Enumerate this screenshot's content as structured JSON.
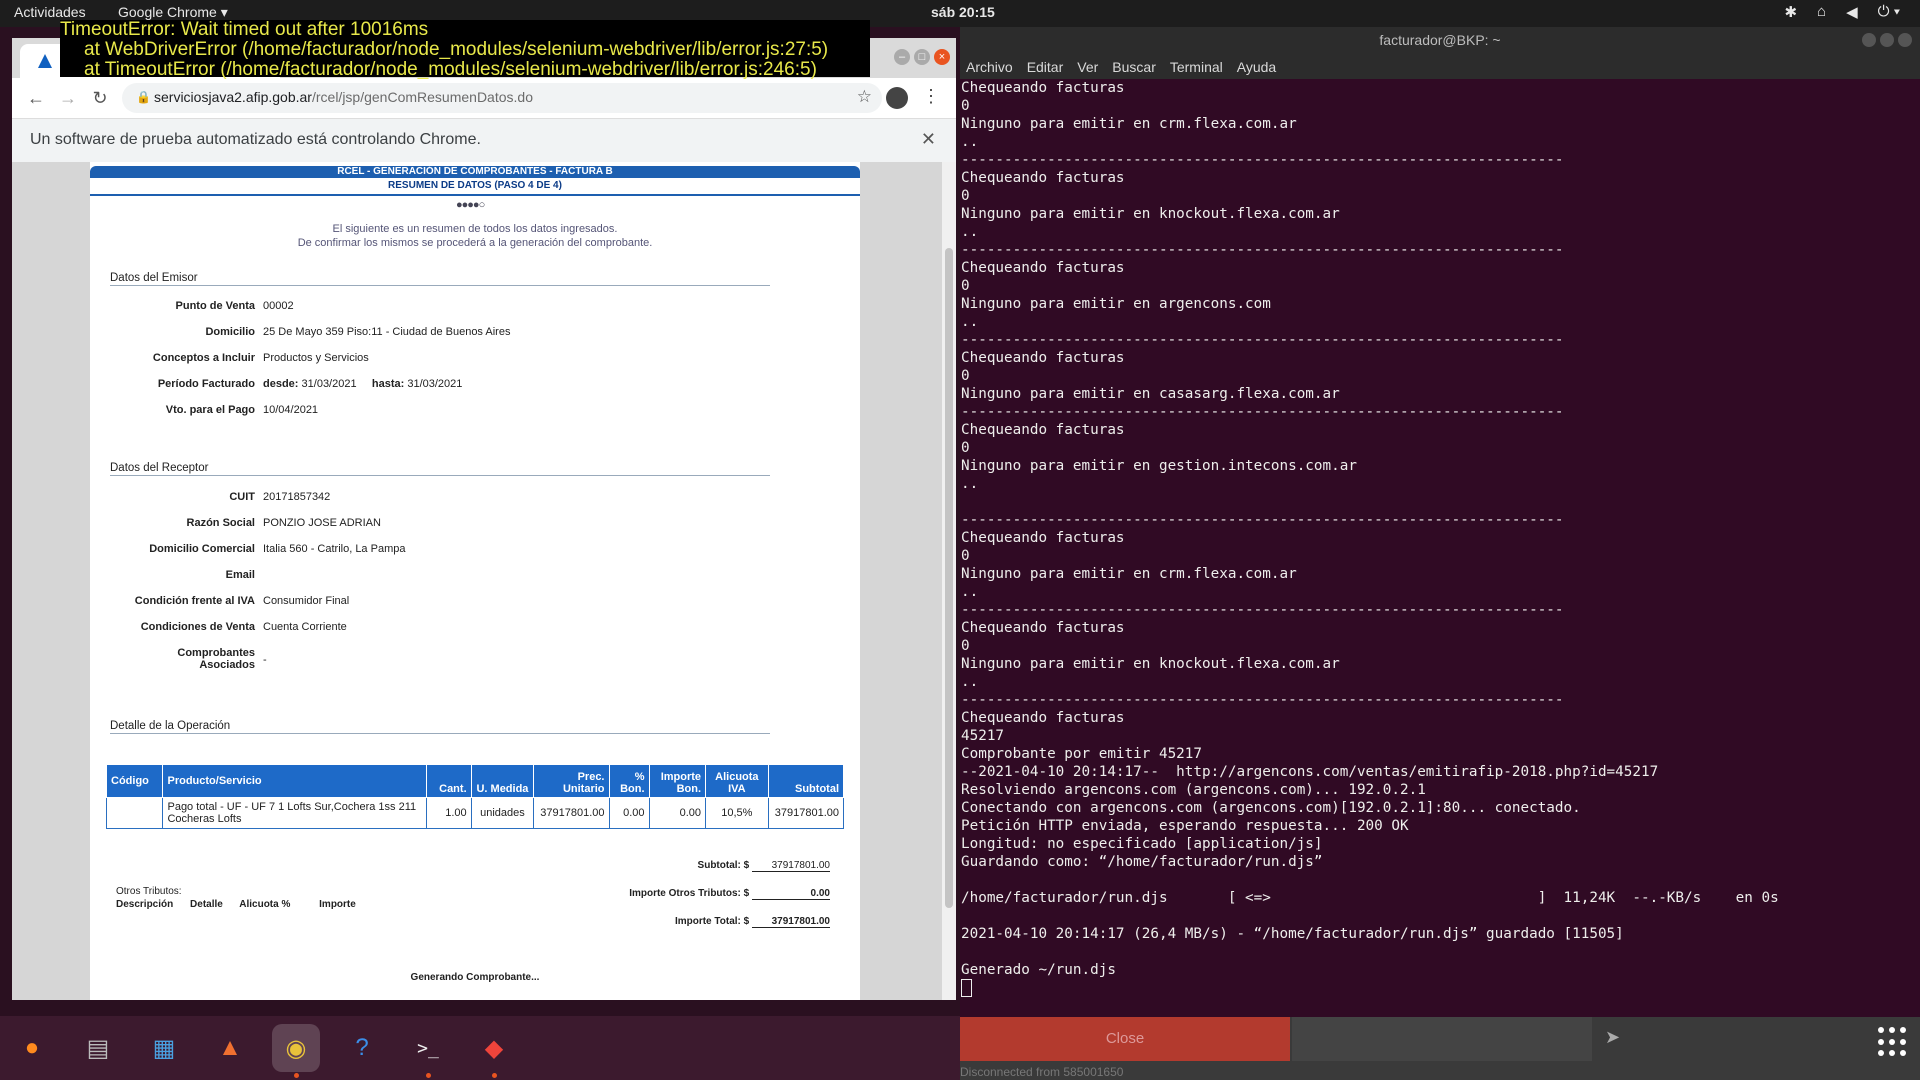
{
  "topbar": {
    "activities": "Actividades",
    "app_menu": "Google Chrome ▾",
    "clock": "sáb 20:15"
  },
  "error": {
    "line1": "TimeoutError: Wait timed out after 10016ms",
    "line2": "at WebDriverError (/home/facturador/node_modules/selenium-webdriver/lib/error.js:27:5)",
    "line3": "at TimeoutError (/home/facturador/node_modules/selenium-webdriver/lib/error.js:246:5)"
  },
  "browser": {
    "url_host": "serviciosjava2.afip.gob.ar",
    "url_path": "/rcel/jsp/genComResumenDatos.do",
    "infobar": "Un software de prueba automatizado está controlando Chrome."
  },
  "afip": {
    "title": "RCEL - GENERACIÓN DE COMPROBANTES - FACTURA B",
    "subtitle": "RESUMEN DE DATOS (PASO 4 DE 4)",
    "steps": "●●●●○",
    "intro1": "El siguiente es un resumen de todos los datos ingresados.",
    "intro2": "De confirmar los mismos se procederá a la generación del comprobante.",
    "emisor": {
      "heading": "Datos del Emisor",
      "punto_venta_label": "Punto de Venta",
      "punto_venta": "00002",
      "domicilio_label": "Domicilio",
      "domicilio": "25 De Mayo 359 Piso:11 - Ciudad de Buenos Aires",
      "conceptos_label": "Conceptos a Incluir",
      "conceptos": "Productos y Servicios",
      "periodo_label": "Período Facturado",
      "desde_label": "desde:",
      "desde": "31/03/2021",
      "hasta_label": "hasta:",
      "hasta": "31/03/2021",
      "vto_label": "Vto. para el Pago",
      "vto": "10/04/2021"
    },
    "receptor": {
      "heading": "Datos del Receptor",
      "cuit_label": "CUIT",
      "cuit": "20171857342",
      "razon_label": "Razón Social",
      "razon": "PONZIO JOSE ADRIAN",
      "domicilio_label": "Domicilio Comercial",
      "domicilio": "Italia 560 - Catrilo, La Pampa",
      "email_label": "Email",
      "email": "",
      "iva_label": "Condición frente al IVA",
      "iva": "Consumidor Final",
      "venta_label": "Condiciones de Venta",
      "venta": "Cuenta Corriente",
      "asoc_label1": "Comprobantes",
      "asoc_label2": "Asociados",
      "asoc": "-"
    },
    "detalle": {
      "heading": "Detalle de la Operación",
      "headers": [
        "Código",
        "Producto/Servicio",
        "Cant.",
        "U. Medida",
        "Prec. Unitario",
        "% Bon.",
        "Importe Bon.",
        "Alicuota IVA",
        "Subtotal"
      ],
      "row": [
        "",
        "Pago total - UF - UF 7 1 Lofts Sur,Cochera 1ss 211 Cocheras Lofts",
        "1.00",
        "unidades",
        "37917801.00",
        "0.00",
        "0.00",
        "10,5%",
        "37917801.00"
      ]
    },
    "totales": {
      "subtotal_label": "Subtotal: $",
      "subtotal": "37917801.00",
      "otros_label": "Importe Otros Tributos: $",
      "otros": "0.00",
      "total_label": "Importe Total: $",
      "total": "37917801.00"
    },
    "otros_tributos": {
      "title": "Otros Tributos:",
      "headers": [
        "Descripción",
        "Detalle",
        "Alicuota %",
        "Importe"
      ]
    },
    "status": "Generando Comprobante..."
  },
  "terminal": {
    "title": "facturador@BKP: ~",
    "menu": [
      "Archivo",
      "Editar",
      "Ver",
      "Buscar",
      "Terminal",
      "Ayuda"
    ],
    "output": "Chequeando facturas\n0\nNinguno para emitir en crm.flexa.com.ar\n..\n----------------------------------------------------------------------\nChequeando facturas\n0\nNinguno para emitir en knockout.flexa.com.ar\n..\n----------------------------------------------------------------------\nChequeando facturas\n0\nNinguno para emitir en argencons.com\n..\n----------------------------------------------------------------------\nChequeando facturas\n0\nNinguno para emitir en casasarg.flexa.com.ar\n----------------------------------------------------------------------\nChequeando facturas\n0\nNinguno para emitir en gestion.intecons.com.ar\n..\n\n----------------------------------------------------------------------\nChequeando facturas\n0\nNinguno para emitir en crm.flexa.com.ar\n..\n----------------------------------------------------------------------\nChequeando facturas\n0\nNinguno para emitir en knockout.flexa.com.ar\n..\n----------------------------------------------------------------------\nChequeando facturas\n45217\nComprobante por emitir 45217\n--2021-04-10 20:14:17--  http://argencons.com/ventas/emitirafip-2018.php?id=45217\nResolviendo argencons.com (argencons.com)... 192.0.2.1\nConectando con argencons.com (argencons.com)[192.0.2.1]:80... conectado.\nPetición HTTP enviada, esperando respuesta... 200 OK\nLongitud: no especificado [application/js]\nGuardando como: “/home/facturador/run.djs”\n\n/home/facturador/run.djs       [ <=>                               ]  11,24K  --.-KB/s    en 0s\n\n2021-04-10 20:14:17 (26,4 MB/s) - “/home/facturador/run.djs” guardado [11505]\n\nGenerado ~/run.djs"
  },
  "overlay": {
    "close_label": "Close",
    "disconnected": "Disconnected from 585001650"
  },
  "dock": {
    "items": [
      "firefox-icon",
      "files-icon",
      "writer-icon",
      "software-icon",
      "chrome-icon",
      "help-icon",
      "terminal-icon",
      "anydesk-icon"
    ]
  }
}
